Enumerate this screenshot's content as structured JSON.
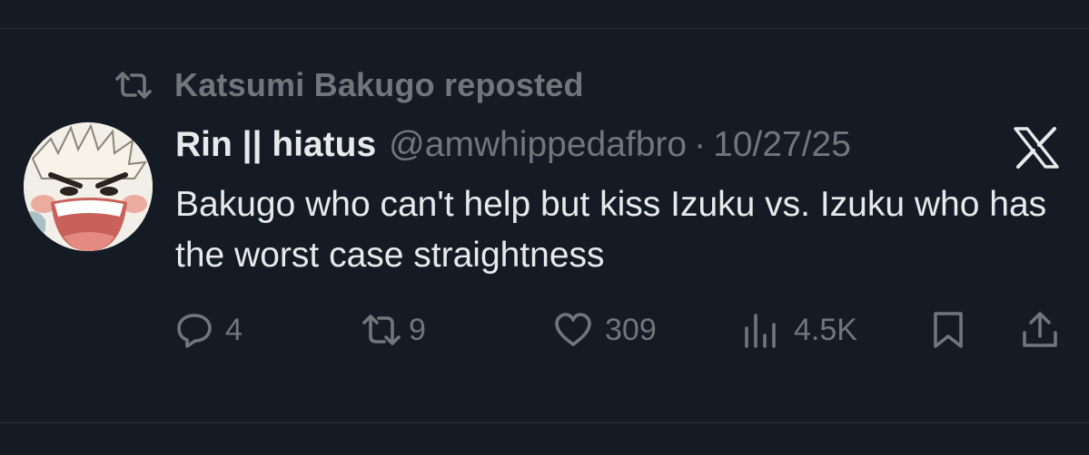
{
  "repost": {
    "label": "Katsumi Bakugo reposted",
    "icon": "repost-icon"
  },
  "post": {
    "display_name": "Rin || hiatus",
    "handle": "@amwhippedafbro",
    "separator": "·",
    "date": "10/27/25",
    "text": "Bakugo who can't help but kiss Izuku vs. Izuku who has the worst case straightness",
    "platform_icon": "x-logo-icon"
  },
  "actions": {
    "reply_count": "4",
    "repost_count": "9",
    "like_count": "309",
    "views_count": "4.5K"
  },
  "colors": {
    "background": "#151b24",
    "primary_text": "#e7e9ea",
    "secondary_text": "#71767b",
    "divider": "#2c333d"
  }
}
